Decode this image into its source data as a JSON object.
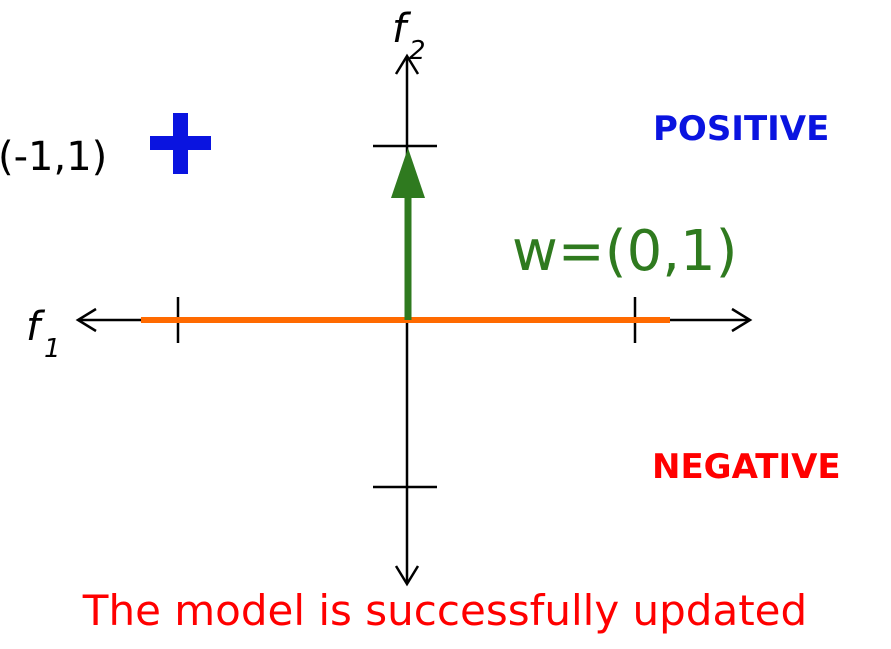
{
  "axes": {
    "x_label": "f",
    "x_subscript": "1",
    "y_label": "f",
    "y_subscript": "2"
  },
  "point": {
    "label": "(-1,1)",
    "class": "+",
    "x": -1,
    "y": 1
  },
  "weight": {
    "label": "w=(0,1)",
    "x": 0,
    "y": 1
  },
  "regions": {
    "positive": "POSITIVE",
    "negative": "NEGATIVE"
  },
  "caption": "The model is successfully updated",
  "colors": {
    "axis": "#000000",
    "point": "#0a14e0",
    "positive": "#0a14e0",
    "negative": "#ff0000",
    "weight_vector": "#2f7a1f",
    "boundary": "#ff6a00",
    "caption": "#ff0000"
  }
}
